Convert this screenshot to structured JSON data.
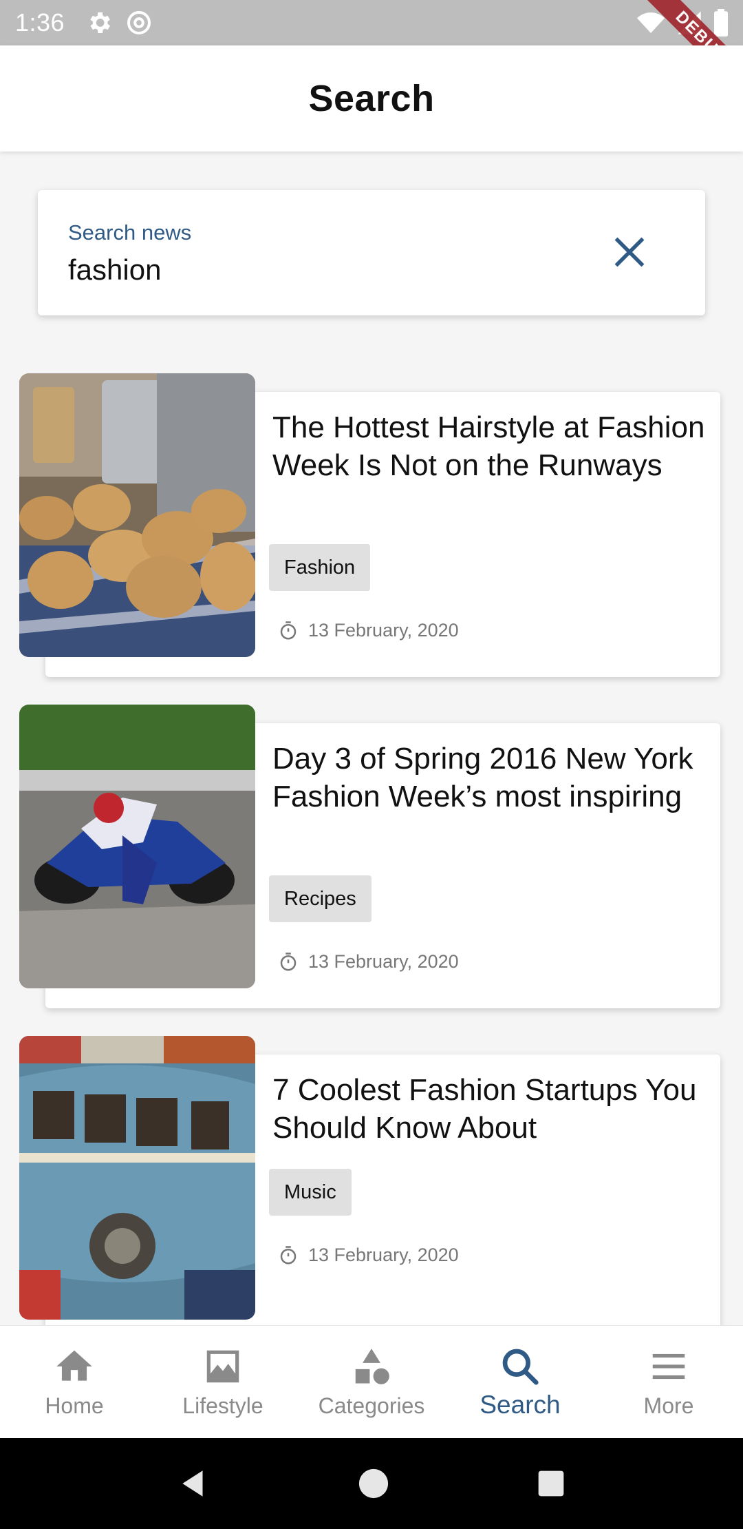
{
  "status_bar": {
    "time": "1:36",
    "debug_label": "DEBUG"
  },
  "app_bar": {
    "title": "Search"
  },
  "search": {
    "label": "Search news",
    "value": "fashion"
  },
  "articles": [
    {
      "title": "The Hottest Hairstyle at Fashion Week Is Not on the Runways",
      "tag": "Fashion",
      "date": "13 February, 2020",
      "image": "potatoes-photo"
    },
    {
      "title": "Day 3 of Spring 2016 New York Fashion Week’s most inspiring",
      "tag": "Recipes",
      "date": "13 February, 2020",
      "image": "motorcycle-photo"
    },
    {
      "title": "7 Coolest Fashion Startups You Should Know About",
      "tag": "Music",
      "date": "13 February, 2020",
      "image": "vw-bus-painting"
    }
  ],
  "bottom_nav": {
    "items": [
      {
        "label": "Home",
        "icon": "home-icon",
        "active": false
      },
      {
        "label": "Lifestyle",
        "icon": "image-icon",
        "active": false
      },
      {
        "label": "Categories",
        "icon": "shapes-icon",
        "active": false
      },
      {
        "label": "Search",
        "icon": "search-icon",
        "active": true
      },
      {
        "label": "More",
        "icon": "menu-icon",
        "active": false
      }
    ]
  },
  "colors": {
    "accent": "#2f5a86",
    "inactive": "#8a8a8a",
    "tag_bg": "#e0e0e0",
    "ribbon": "#a0252c"
  }
}
